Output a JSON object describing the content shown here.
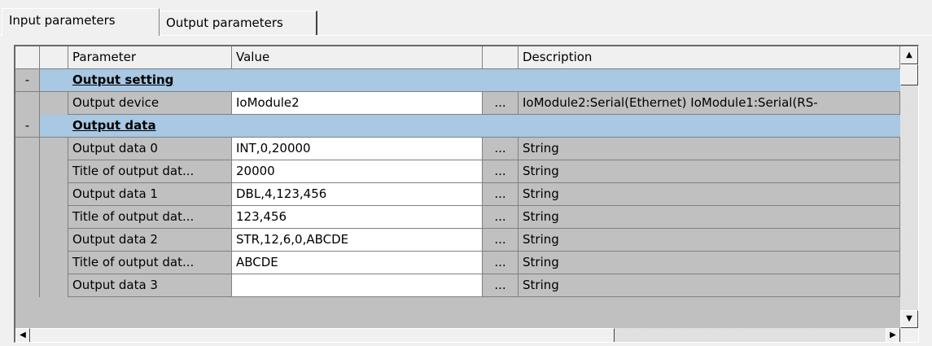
{
  "tabs": [
    {
      "label": "Input parameters",
      "active": true
    },
    {
      "label": "Output parameters",
      "active": false
    }
  ],
  "grid": {
    "columns": {
      "parameter": "Parameter",
      "value": "Value",
      "button": "",
      "description": "Description"
    },
    "groups": [
      {
        "toggle": "-",
        "title": "Output setting"
      },
      {
        "toggle": "-",
        "title": "Output data"
      }
    ],
    "rows": [
      {
        "parameter": "Output device",
        "value": "IoModule2",
        "button": "...",
        "description": "IoModule2:Serial(Ethernet) IoModule1:Serial(RS-"
      },
      {
        "parameter": "Output data 0",
        "value": "INT,0,20000",
        "button": "...",
        "description": "String"
      },
      {
        "parameter": "Title of output dat...",
        "value": "20000",
        "button": "...",
        "description": "String"
      },
      {
        "parameter": "Output data 1",
        "value": "DBL,4,123,456",
        "button": "...",
        "description": "String"
      },
      {
        "parameter": "Title of output dat...",
        "value": "123,456",
        "button": "...",
        "description": "String"
      },
      {
        "parameter": "Output data 2",
        "value": "STR,12,6,0,ABCDE",
        "button": "...",
        "description": "String"
      },
      {
        "parameter": "Title of output dat...",
        "value": "ABCDE",
        "button": "...",
        "description": "String"
      },
      {
        "parameter": "Output data 3",
        "value": "",
        "button": "...",
        "description": "String"
      }
    ]
  },
  "scrollbars": {
    "up_icon": "arrow-up-icon",
    "down_icon": "arrow-down-icon",
    "left_icon": "arrow-left-icon",
    "right_icon": "arrow-right-icon"
  },
  "colors": {
    "group_row": "#a8c8e4",
    "grid_background": "#c0c0c0",
    "value_cell": "#ffffff"
  }
}
